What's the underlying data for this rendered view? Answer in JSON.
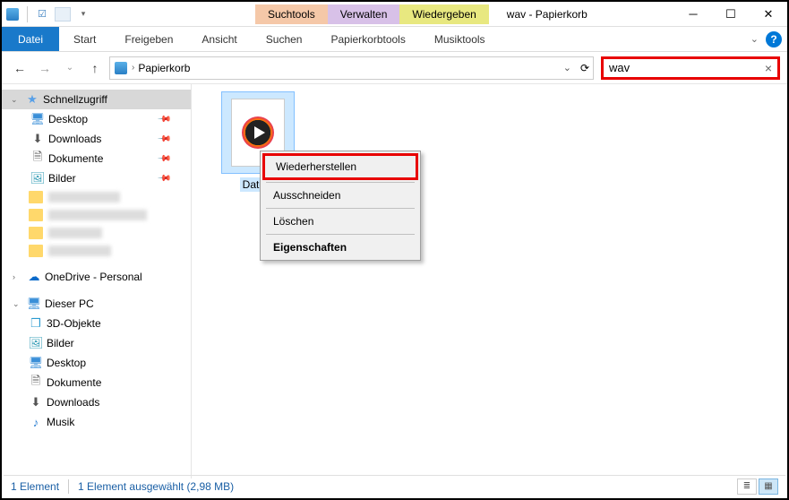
{
  "window": {
    "title": "wav - Papierkorb"
  },
  "ribbon": {
    "contextual": {
      "such": "Suchtools",
      "verw": "Verwalten",
      "wied": "Wiedergeben"
    },
    "file": "Datei",
    "tabs": {
      "start": "Start",
      "freigeben": "Freigeben",
      "ansicht": "Ansicht",
      "suchen": "Suchen",
      "papierkorb": "Papierkorbtools",
      "musik": "Musiktools"
    }
  },
  "path": {
    "location": "Papierkorb"
  },
  "search": {
    "value": "wav"
  },
  "sidebar": {
    "quick": "Schnellzugriff",
    "desktop": "Desktop",
    "downloads": "Downloads",
    "dokumente": "Dokumente",
    "bilder": "Bilder",
    "onedrive": "OneDrive - Personal",
    "thispc": "Dieser PC",
    "obj3d": "3D-Objekte",
    "bilder2": "Bilder",
    "desktop2": "Desktop",
    "dokumente2": "Dokumente",
    "downloads2": "Downloads",
    "musik": "Musik"
  },
  "file": {
    "name": "Datei_"
  },
  "context_menu": {
    "restore": "Wiederherstellen",
    "cut": "Ausschneiden",
    "delete": "Löschen",
    "props": "Eigenschaften"
  },
  "status": {
    "count": "1 Element",
    "selection": "1 Element ausgewählt (2,98 MB)"
  }
}
